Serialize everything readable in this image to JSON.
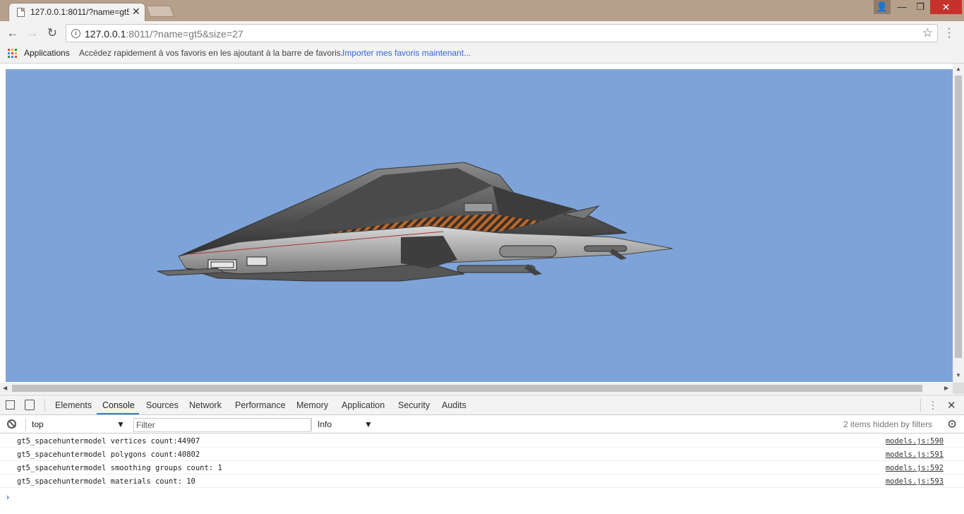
{
  "window": {
    "tab_title": "127.0.0.1:8011/?name=gt5&size=27",
    "tab_close": "✕",
    "controls": {
      "user": "👤",
      "minimize": "—",
      "maximize": "❐",
      "close": "✕"
    }
  },
  "toolbar": {
    "back": "←",
    "forward": "→",
    "reload": "↻",
    "url_host": "127.0.0.1",
    "url_rest": ":8011/?name=gt5&size=27",
    "info": "i",
    "star": "☆",
    "menu": "⋮"
  },
  "bookmarks": {
    "apps_label": "Applications",
    "hint": "Accédez rapidement à vos favoris en les ajoutant à la barre de favoris.",
    "import_link": "Importer mes favoris maintenant..."
  },
  "viewer": {
    "background_color": "#7ea3d8",
    "model_name": "gt5"
  },
  "devtools": {
    "tabs": [
      "Elements",
      "Console",
      "Sources",
      "Network",
      "Performance",
      "Memory",
      "Application",
      "Security",
      "Audits"
    ],
    "active_tab": "Console",
    "more": "⋮",
    "close": "✕",
    "filterbar": {
      "context": "top",
      "filter_placeholder": "Filter",
      "level": "Info",
      "hidden_message": "2 items hidden by filters",
      "settings": "⚙"
    },
    "logs": [
      {
        "message": "gt5_spacehuntermodel vertices count:44907",
        "source": "models.js:590"
      },
      {
        "message": "gt5_spacehuntermodel polygons count:40802",
        "source": "models.js:591"
      },
      {
        "message": "gt5_spacehuntermodel smoothing groups count: 1",
        "source": "models.js:592"
      },
      {
        "message": "gt5_spacehuntermodel materials count: 10",
        "source": "models.js:593"
      }
    ],
    "prompt": "›"
  }
}
